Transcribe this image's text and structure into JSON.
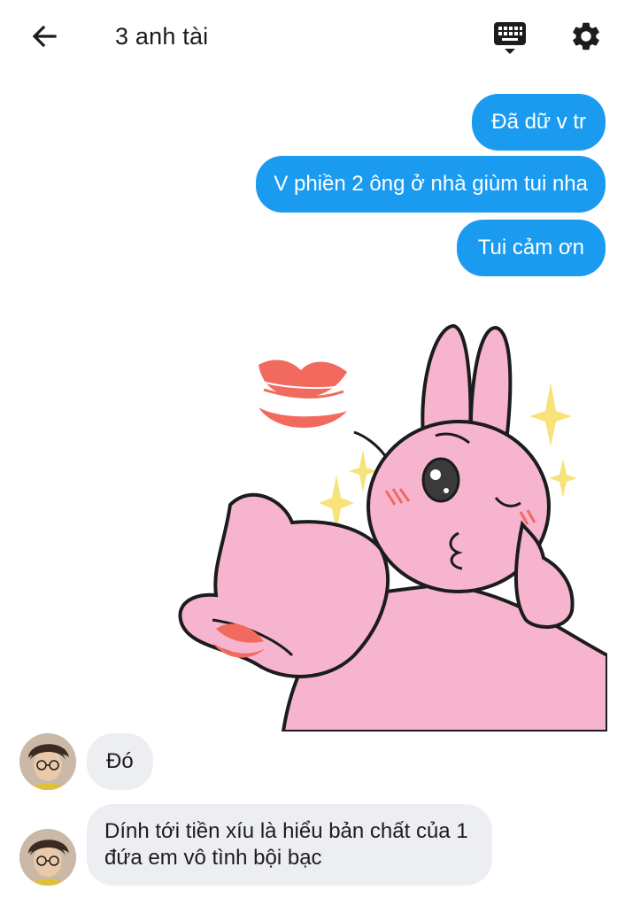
{
  "header": {
    "title": "3 anh tài",
    "back_icon": "arrow-left-icon",
    "keyboard_icon": "keyboard-icon",
    "settings_icon": "gear-icon"
  },
  "messages": {
    "outgoing": [
      "Đã dữ v tr",
      "V phiền 2 ông ở nhà giùm tui nha",
      "Tui cảm ơn"
    ],
    "incoming": [
      "Đó",
      "Dính tới tiền xíu là hiểu bản chất của 1 đứa em vô tình bội bạc"
    ]
  },
  "colors": {
    "outgoing_bubble": "#1b9bf0",
    "incoming_bubble": "#eceef1",
    "sticker_pink": "#f7b4ce",
    "kiss_red": "#f26a5e",
    "sparkle_yellow": "#f7e37a"
  }
}
